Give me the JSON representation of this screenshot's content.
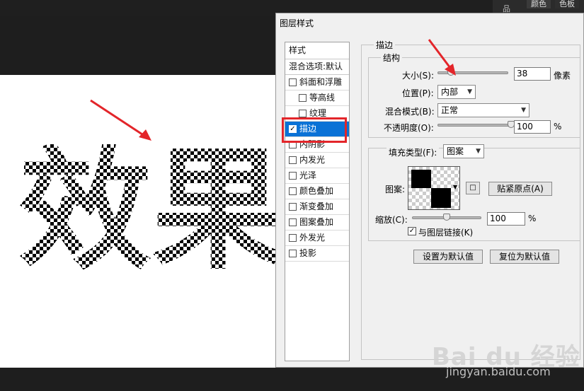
{
  "workspace": {
    "panel_tabs": [
      "颜色",
      "色板"
    ],
    "corner_glyph": "品"
  },
  "canvas": {
    "glyphs": [
      "效",
      "果"
    ]
  },
  "dialog": {
    "title": "图层样式",
    "style_list": {
      "header": "样式",
      "blend_options": "混合选项:默认",
      "items": [
        {
          "label": "斜面和浮雕",
          "checked": false,
          "indent": false
        },
        {
          "label": "等高线",
          "checked": false,
          "indent": true
        },
        {
          "label": "纹理",
          "checked": false,
          "indent": true
        },
        {
          "label": "描边",
          "checked": true,
          "indent": false,
          "active": true
        },
        {
          "label": "内阴影",
          "checked": false,
          "indent": false
        },
        {
          "label": "内发光",
          "checked": false,
          "indent": false
        },
        {
          "label": "光泽",
          "checked": false,
          "indent": false
        },
        {
          "label": "颜色叠加",
          "checked": false,
          "indent": false
        },
        {
          "label": "渐变叠加",
          "checked": false,
          "indent": false
        },
        {
          "label": "图案叠加",
          "checked": false,
          "indent": false
        },
        {
          "label": "外发光",
          "checked": false,
          "indent": false
        },
        {
          "label": "投影",
          "checked": false,
          "indent": false
        }
      ]
    },
    "stroke": {
      "group_title": "描边",
      "structure_title": "结构",
      "size_label": "大小(S):",
      "size_value": "38",
      "size_unit": "像素",
      "size_slider_fraction": 0.19,
      "position_label": "位置(P):",
      "position_value": "内部",
      "blend_label": "混合模式(B):",
      "blend_value": "正常",
      "opacity_label": "不透明度(O):",
      "opacity_value": "100",
      "opacity_unit": "%",
      "opacity_slider_fraction": 1.0,
      "fill_type_label": "填充类型(F):",
      "fill_type_value": "图案",
      "pattern_label": "图案:",
      "snap_origin_button": "贴紧原点(A)",
      "scale_label": "缩放(C):",
      "scale_value": "100",
      "scale_unit": "%",
      "scale_slider_fraction": 0.5,
      "link_label": "与图层链接(K)",
      "link_checked": true,
      "set_default_button": "设置为默认值",
      "reset_default_button": "复位为默认值"
    }
  },
  "watermark": {
    "logo": "Bai du 经验",
    "url": "jingyan.baidu.com"
  },
  "colors": {
    "active_item": "#0a72d6",
    "highlight_red": "#e3252a"
  }
}
